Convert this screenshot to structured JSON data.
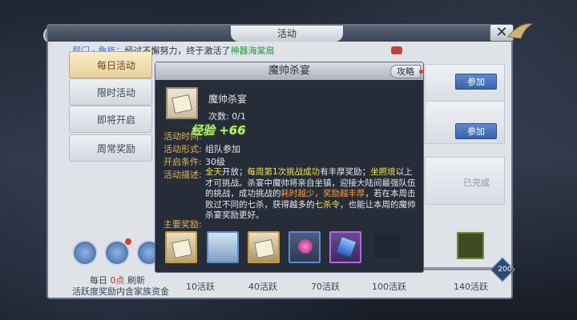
{
  "window": {
    "title": "活动",
    "close_label": "✕"
  },
  "announcement": {
    "prefix": "帮门 · 鲁族：",
    "text": "经过不懈努力，终于激活了",
    "item": "神器海棠扇"
  },
  "tabs": [
    {
      "label": "每日活动",
      "active": true
    },
    {
      "label": "限时活动",
      "active": false
    },
    {
      "label": "即将开启",
      "active": false
    },
    {
      "label": "周常奖励",
      "active": false
    }
  ],
  "right_list": {
    "join_label": "参加",
    "done_label": "已完成"
  },
  "popup": {
    "title": "魔帅杀宴",
    "guide_label": "攻略",
    "event_name": "魔帅杀宴",
    "count_label": "次数: 0/1",
    "exp_gain": "经验 +66",
    "time_label": "活动时间:",
    "form_label": "活动形式:",
    "form_value": "组队参加",
    "condition_label": "开启条件:",
    "condition_value": "30级",
    "desc_label": "活动描述:",
    "desc": {
      "p1": "全天",
      "p2": "开放；",
      "p3": "每周第1次挑战成功",
      "p4": "有丰厚奖励；",
      "p5": "坐照境",
      "p6": "以上才可挑战。杀宴中魔帅将亲自坐镇，迎接大陆间最强队伍的挑战，成功挑战的",
      "p7": "耗时越少，奖励越丰厚",
      "p8": "，若在本周击败过不同的七杀，获得越多的",
      "p9": "七杀令",
      "p10": "，也能让本周的魔帅杀宴奖励更好。"
    },
    "reward_label": "主要奖励:"
  },
  "bottom": {
    "daily_prefix": "每日",
    "daily_time": "0点",
    "daily_suffix": "刷新",
    "family_fund": "活跃度奖励内含家族资金",
    "progress_fraction": 0.0,
    "progress_end": "200",
    "milestones": [
      "10活跃",
      "40活跃",
      "70活跃",
      "100活跃",
      "140活跃"
    ]
  },
  "colors": {
    "accent_gold": "#e2b453",
    "highlight_yellow": "#f2e54d",
    "highlight_green": "#6fe06a",
    "join_blue": "#3b63a8"
  }
}
